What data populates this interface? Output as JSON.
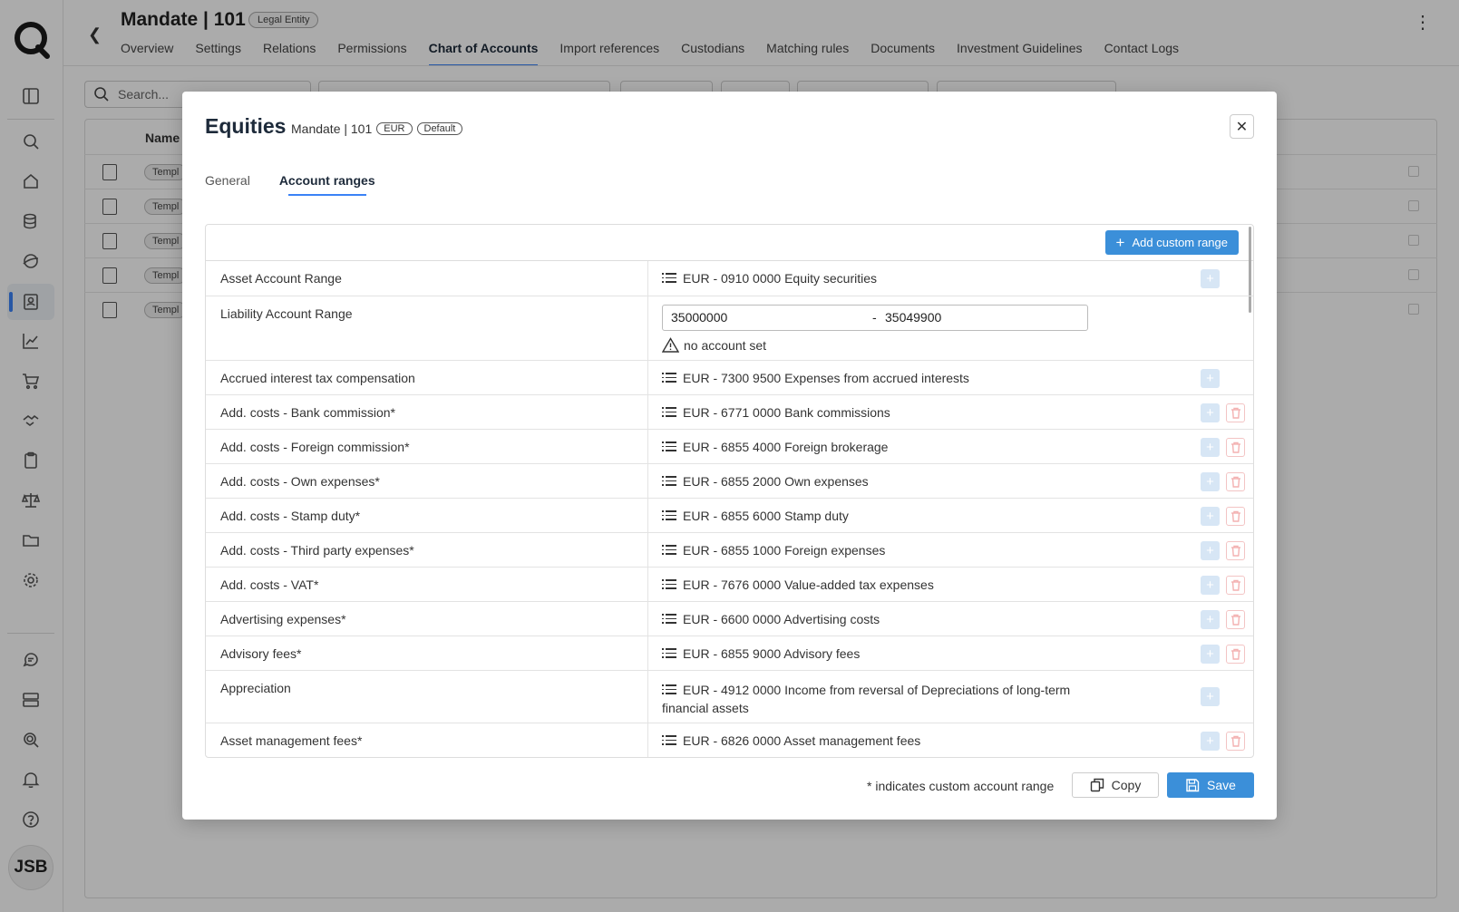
{
  "header": {
    "title": "Mandate | 101",
    "badge": "Legal Entity",
    "tabs": [
      "Overview",
      "Settings",
      "Relations",
      "Permissions",
      "Chart of Accounts",
      "Import references",
      "Custodians",
      "Matching rules",
      "Documents",
      "Investment Guidelines",
      "Contact Logs"
    ],
    "active_tab": "Chart of Accounts"
  },
  "user": {
    "initials": "JSB"
  },
  "background": {
    "search_placeholder": "Search...",
    "column_name": "Name",
    "row_tag": "Templ"
  },
  "modal": {
    "title": "Equities",
    "subtitle": "Mandate | 101",
    "currency_pill": "EUR",
    "default_pill": "Default",
    "tabs": [
      "General",
      "Account ranges"
    ],
    "active_tab": "Account ranges",
    "add_custom_range": "Add custom range",
    "liability": {
      "label": "Liability Account Range",
      "from": "35000000",
      "separator": "-",
      "to": "35049900",
      "warning": "no account set"
    },
    "rows": [
      {
        "label": "Asset Account Range",
        "value": "EUR - 0910 0000 Equity securities",
        "deletable": false
      },
      {
        "label": "Accrued interest tax compensation",
        "value": "EUR - 7300 9500 Expenses from accrued interests",
        "deletable": false
      },
      {
        "label": "Add. costs - Bank commission*",
        "value": "EUR - 6771 0000 Bank commissions",
        "deletable": true
      },
      {
        "label": "Add. costs - Foreign commission*",
        "value": "EUR - 6855 4000 Foreign brokerage",
        "deletable": true
      },
      {
        "label": "Add. costs - Own expenses*",
        "value": "EUR - 6855 2000 Own expenses",
        "deletable": true
      },
      {
        "label": "Add. costs - Stamp duty*",
        "value": "EUR - 6855 6000 Stamp duty",
        "deletable": true
      },
      {
        "label": "Add. costs - Third party expenses*",
        "value": "EUR - 6855 1000 Foreign expenses",
        "deletable": true
      },
      {
        "label": "Add. costs - VAT*",
        "value": "EUR - 7676 0000 Value-added tax expenses",
        "deletable": true
      },
      {
        "label": "Advertising expenses*",
        "value": "EUR - 6600 0000 Advertising costs",
        "deletable": true
      },
      {
        "label": "Advisory fees*",
        "value": "EUR - 6855 9000 Advisory fees",
        "deletable": true
      },
      {
        "label": "Appreciation",
        "value": "EUR - 4912 0000 Income from reversal of Depreciations of long-term financial assets",
        "deletable": false
      },
      {
        "label": "Asset management fees*",
        "value": "EUR - 6826 0000 Asset management fees",
        "deletable": true
      }
    ],
    "footer_note": "* indicates custom account range",
    "copy_label": "Copy",
    "save_label": "Save"
  }
}
